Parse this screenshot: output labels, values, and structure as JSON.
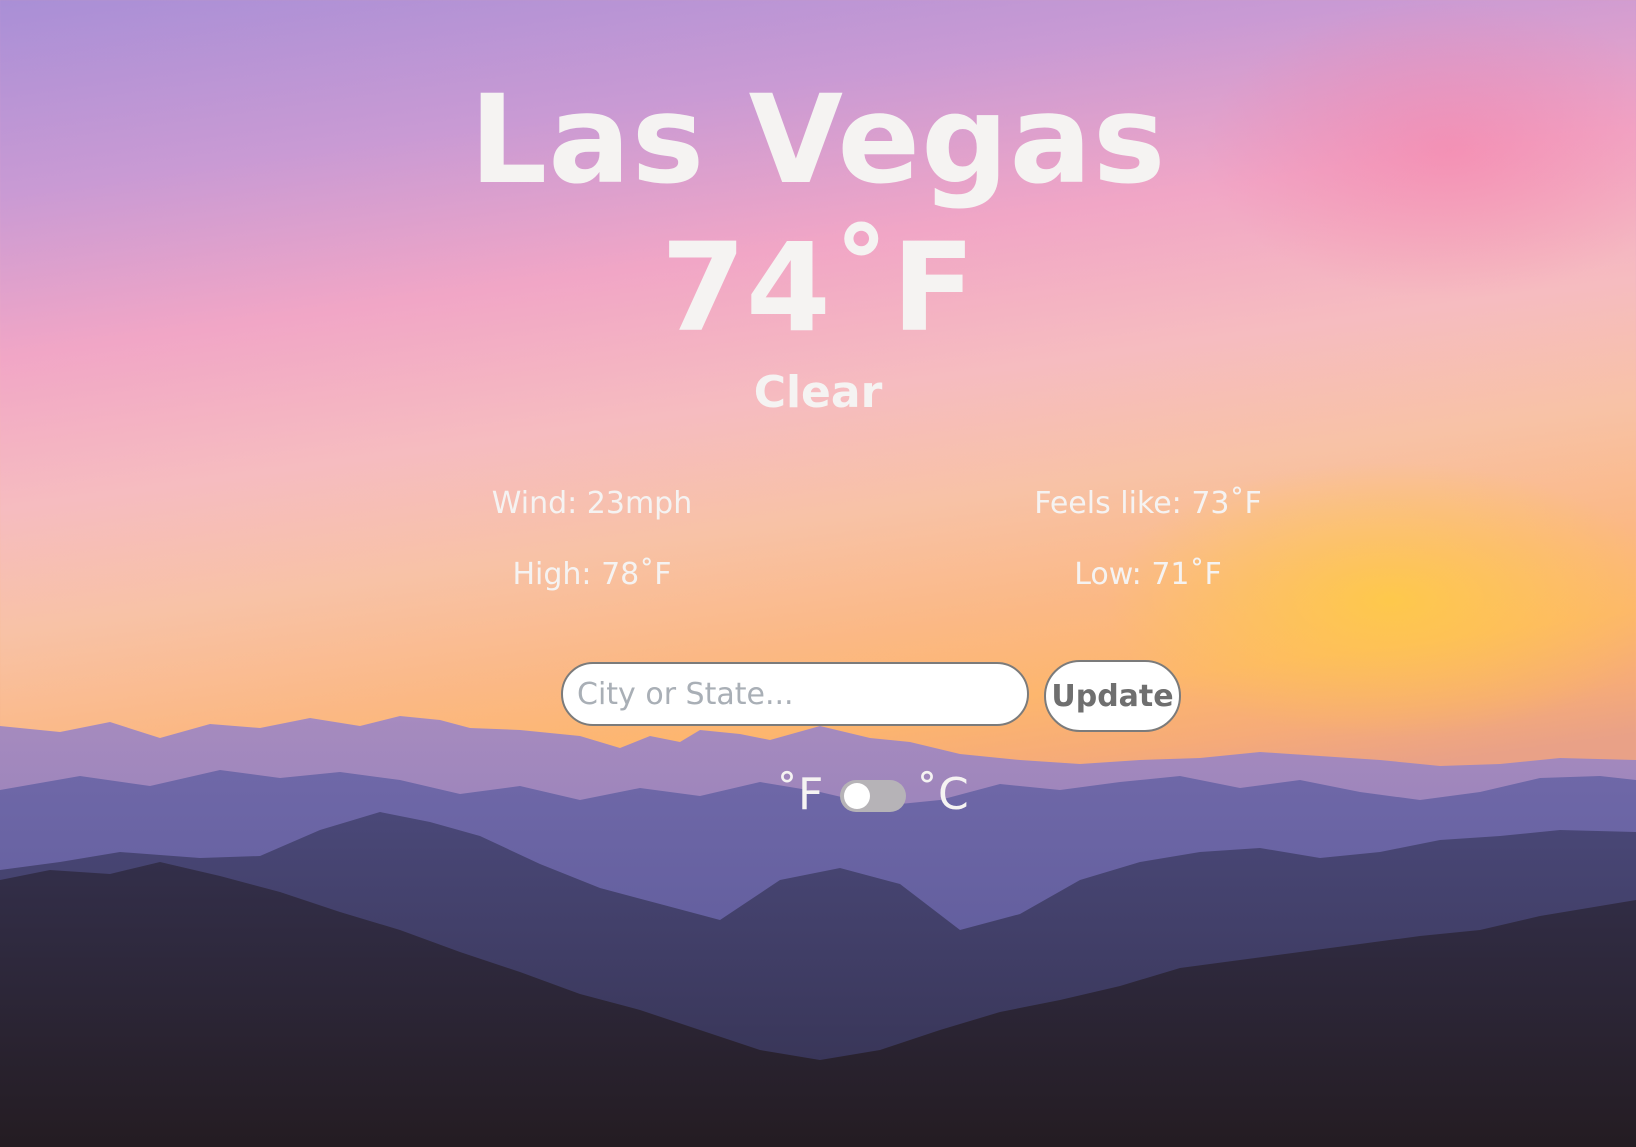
{
  "weather": {
    "city": "Las Vegas",
    "temperature": "74˚F",
    "condition": "Clear",
    "wind": "Wind: 23mph",
    "feels_like": "Feels like: 73˚F",
    "high": "High: 78˚F",
    "low": "Low: 71˚F"
  },
  "search": {
    "placeholder": "City or State...",
    "value": "",
    "button_label": "Update"
  },
  "units": {
    "fahrenheit_label": "˚F",
    "celsius_label": "˚C",
    "celsius_selected": false
  },
  "colors": {
    "text": "#f5f3f2",
    "button_text": "#6f6f6f",
    "toggle_track": "#b6b3b7"
  }
}
